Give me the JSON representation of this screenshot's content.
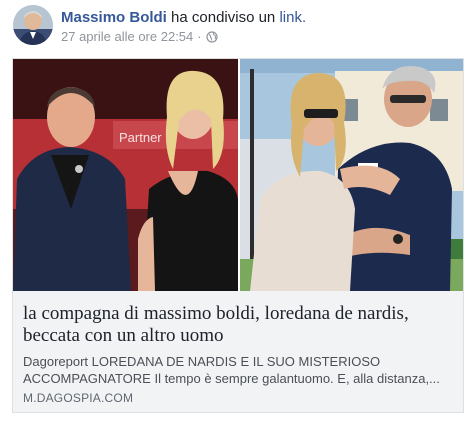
{
  "post": {
    "author": "Massimo Boldi",
    "action_text": "ha condiviso un",
    "action_link": "link.",
    "timestamp": "27 aprile alle ore 22:54",
    "separator": "·",
    "privacy_icon": "globe-icon"
  },
  "link_card": {
    "backdrop_text": "Partner",
    "title": "la compagna di massimo boldi, loredana de nardis, beccata con un altro uomo",
    "description": "Dagoreport LOREDANA DE NARDIS E IL SUO MISTERIOSO ACCOMPAGNATORE Il tempo è sempre galantuomo. E, alla distanza,...",
    "domain": "M.DAGOSPIA.COM"
  },
  "colors": {
    "link_blue": "#365899",
    "meta_gray": "#90949c",
    "card_bg": "#f2f3f5"
  }
}
